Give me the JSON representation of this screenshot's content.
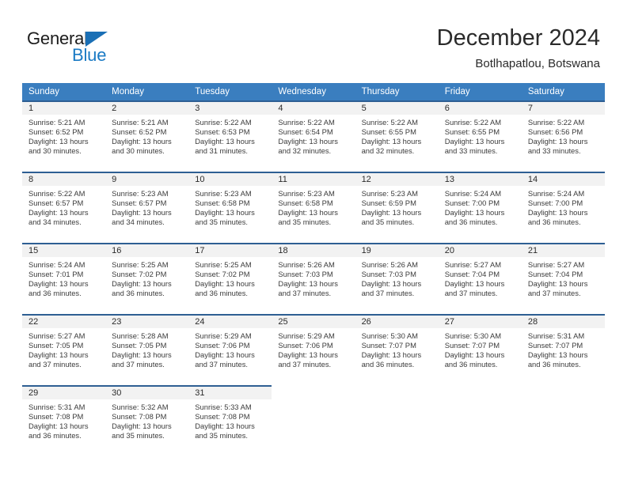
{
  "brand": {
    "word_one": "General",
    "word_two": "Blue",
    "flag_icon": "blue-triangle-flag-icon",
    "colors": {
      "dark": "#1c1c1c",
      "blue": "#1a7ac4"
    }
  },
  "header": {
    "title": "December 2024",
    "subtitle": "Botlhapatlou, Botswana"
  },
  "calendar": {
    "accent_header_color": "#3a7ebf",
    "cell_top_border_color": "#2e5f93",
    "daynum_band_color": "#f2f2f2",
    "weekday_headers": [
      "Sunday",
      "Monday",
      "Tuesday",
      "Wednesday",
      "Thursday",
      "Friday",
      "Saturday"
    ],
    "weeks": [
      [
        {
          "day": "1",
          "sunrise": "Sunrise: 5:21 AM",
          "sunset": "Sunset: 6:52 PM",
          "daylight1": "Daylight: 13 hours",
          "daylight2": "and 30 minutes."
        },
        {
          "day": "2",
          "sunrise": "Sunrise: 5:21 AM",
          "sunset": "Sunset: 6:52 PM",
          "daylight1": "Daylight: 13 hours",
          "daylight2": "and 30 minutes."
        },
        {
          "day": "3",
          "sunrise": "Sunrise: 5:22 AM",
          "sunset": "Sunset: 6:53 PM",
          "daylight1": "Daylight: 13 hours",
          "daylight2": "and 31 minutes."
        },
        {
          "day": "4",
          "sunrise": "Sunrise: 5:22 AM",
          "sunset": "Sunset: 6:54 PM",
          "daylight1": "Daylight: 13 hours",
          "daylight2": "and 32 minutes."
        },
        {
          "day": "5",
          "sunrise": "Sunrise: 5:22 AM",
          "sunset": "Sunset: 6:55 PM",
          "daylight1": "Daylight: 13 hours",
          "daylight2": "and 32 minutes."
        },
        {
          "day": "6",
          "sunrise": "Sunrise: 5:22 AM",
          "sunset": "Sunset: 6:55 PM",
          "daylight1": "Daylight: 13 hours",
          "daylight2": "and 33 minutes."
        },
        {
          "day": "7",
          "sunrise": "Sunrise: 5:22 AM",
          "sunset": "Sunset: 6:56 PM",
          "daylight1": "Daylight: 13 hours",
          "daylight2": "and 33 minutes."
        }
      ],
      [
        {
          "day": "8",
          "sunrise": "Sunrise: 5:22 AM",
          "sunset": "Sunset: 6:57 PM",
          "daylight1": "Daylight: 13 hours",
          "daylight2": "and 34 minutes."
        },
        {
          "day": "9",
          "sunrise": "Sunrise: 5:23 AM",
          "sunset": "Sunset: 6:57 PM",
          "daylight1": "Daylight: 13 hours",
          "daylight2": "and 34 minutes."
        },
        {
          "day": "10",
          "sunrise": "Sunrise: 5:23 AM",
          "sunset": "Sunset: 6:58 PM",
          "daylight1": "Daylight: 13 hours",
          "daylight2": "and 35 minutes."
        },
        {
          "day": "11",
          "sunrise": "Sunrise: 5:23 AM",
          "sunset": "Sunset: 6:58 PM",
          "daylight1": "Daylight: 13 hours",
          "daylight2": "and 35 minutes."
        },
        {
          "day": "12",
          "sunrise": "Sunrise: 5:23 AM",
          "sunset": "Sunset: 6:59 PM",
          "daylight1": "Daylight: 13 hours",
          "daylight2": "and 35 minutes."
        },
        {
          "day": "13",
          "sunrise": "Sunrise: 5:24 AM",
          "sunset": "Sunset: 7:00 PM",
          "daylight1": "Daylight: 13 hours",
          "daylight2": "and 36 minutes."
        },
        {
          "day": "14",
          "sunrise": "Sunrise: 5:24 AM",
          "sunset": "Sunset: 7:00 PM",
          "daylight1": "Daylight: 13 hours",
          "daylight2": "and 36 minutes."
        }
      ],
      [
        {
          "day": "15",
          "sunrise": "Sunrise: 5:24 AM",
          "sunset": "Sunset: 7:01 PM",
          "daylight1": "Daylight: 13 hours",
          "daylight2": "and 36 minutes."
        },
        {
          "day": "16",
          "sunrise": "Sunrise: 5:25 AM",
          "sunset": "Sunset: 7:02 PM",
          "daylight1": "Daylight: 13 hours",
          "daylight2": "and 36 minutes."
        },
        {
          "day": "17",
          "sunrise": "Sunrise: 5:25 AM",
          "sunset": "Sunset: 7:02 PM",
          "daylight1": "Daylight: 13 hours",
          "daylight2": "and 36 minutes."
        },
        {
          "day": "18",
          "sunrise": "Sunrise: 5:26 AM",
          "sunset": "Sunset: 7:03 PM",
          "daylight1": "Daylight: 13 hours",
          "daylight2": "and 37 minutes."
        },
        {
          "day": "19",
          "sunrise": "Sunrise: 5:26 AM",
          "sunset": "Sunset: 7:03 PM",
          "daylight1": "Daylight: 13 hours",
          "daylight2": "and 37 minutes."
        },
        {
          "day": "20",
          "sunrise": "Sunrise: 5:27 AM",
          "sunset": "Sunset: 7:04 PM",
          "daylight1": "Daylight: 13 hours",
          "daylight2": "and 37 minutes."
        },
        {
          "day": "21",
          "sunrise": "Sunrise: 5:27 AM",
          "sunset": "Sunset: 7:04 PM",
          "daylight1": "Daylight: 13 hours",
          "daylight2": "and 37 minutes."
        }
      ],
      [
        {
          "day": "22",
          "sunrise": "Sunrise: 5:27 AM",
          "sunset": "Sunset: 7:05 PM",
          "daylight1": "Daylight: 13 hours",
          "daylight2": "and 37 minutes."
        },
        {
          "day": "23",
          "sunrise": "Sunrise: 5:28 AM",
          "sunset": "Sunset: 7:05 PM",
          "daylight1": "Daylight: 13 hours",
          "daylight2": "and 37 minutes."
        },
        {
          "day": "24",
          "sunrise": "Sunrise: 5:29 AM",
          "sunset": "Sunset: 7:06 PM",
          "daylight1": "Daylight: 13 hours",
          "daylight2": "and 37 minutes."
        },
        {
          "day": "25",
          "sunrise": "Sunrise: 5:29 AM",
          "sunset": "Sunset: 7:06 PM",
          "daylight1": "Daylight: 13 hours",
          "daylight2": "and 37 minutes."
        },
        {
          "day": "26",
          "sunrise": "Sunrise: 5:30 AM",
          "sunset": "Sunset: 7:07 PM",
          "daylight1": "Daylight: 13 hours",
          "daylight2": "and 36 minutes."
        },
        {
          "day": "27",
          "sunrise": "Sunrise: 5:30 AM",
          "sunset": "Sunset: 7:07 PM",
          "daylight1": "Daylight: 13 hours",
          "daylight2": "and 36 minutes."
        },
        {
          "day": "28",
          "sunrise": "Sunrise: 5:31 AM",
          "sunset": "Sunset: 7:07 PM",
          "daylight1": "Daylight: 13 hours",
          "daylight2": "and 36 minutes."
        }
      ],
      [
        {
          "day": "29",
          "sunrise": "Sunrise: 5:31 AM",
          "sunset": "Sunset: 7:08 PM",
          "daylight1": "Daylight: 13 hours",
          "daylight2": "and 36 minutes."
        },
        {
          "day": "30",
          "sunrise": "Sunrise: 5:32 AM",
          "sunset": "Sunset: 7:08 PM",
          "daylight1": "Daylight: 13 hours",
          "daylight2": "and 35 minutes."
        },
        {
          "day": "31",
          "sunrise": "Sunrise: 5:33 AM",
          "sunset": "Sunset: 7:08 PM",
          "daylight1": "Daylight: 13 hours",
          "daylight2": "and 35 minutes."
        },
        null,
        null,
        null,
        null
      ]
    ]
  }
}
